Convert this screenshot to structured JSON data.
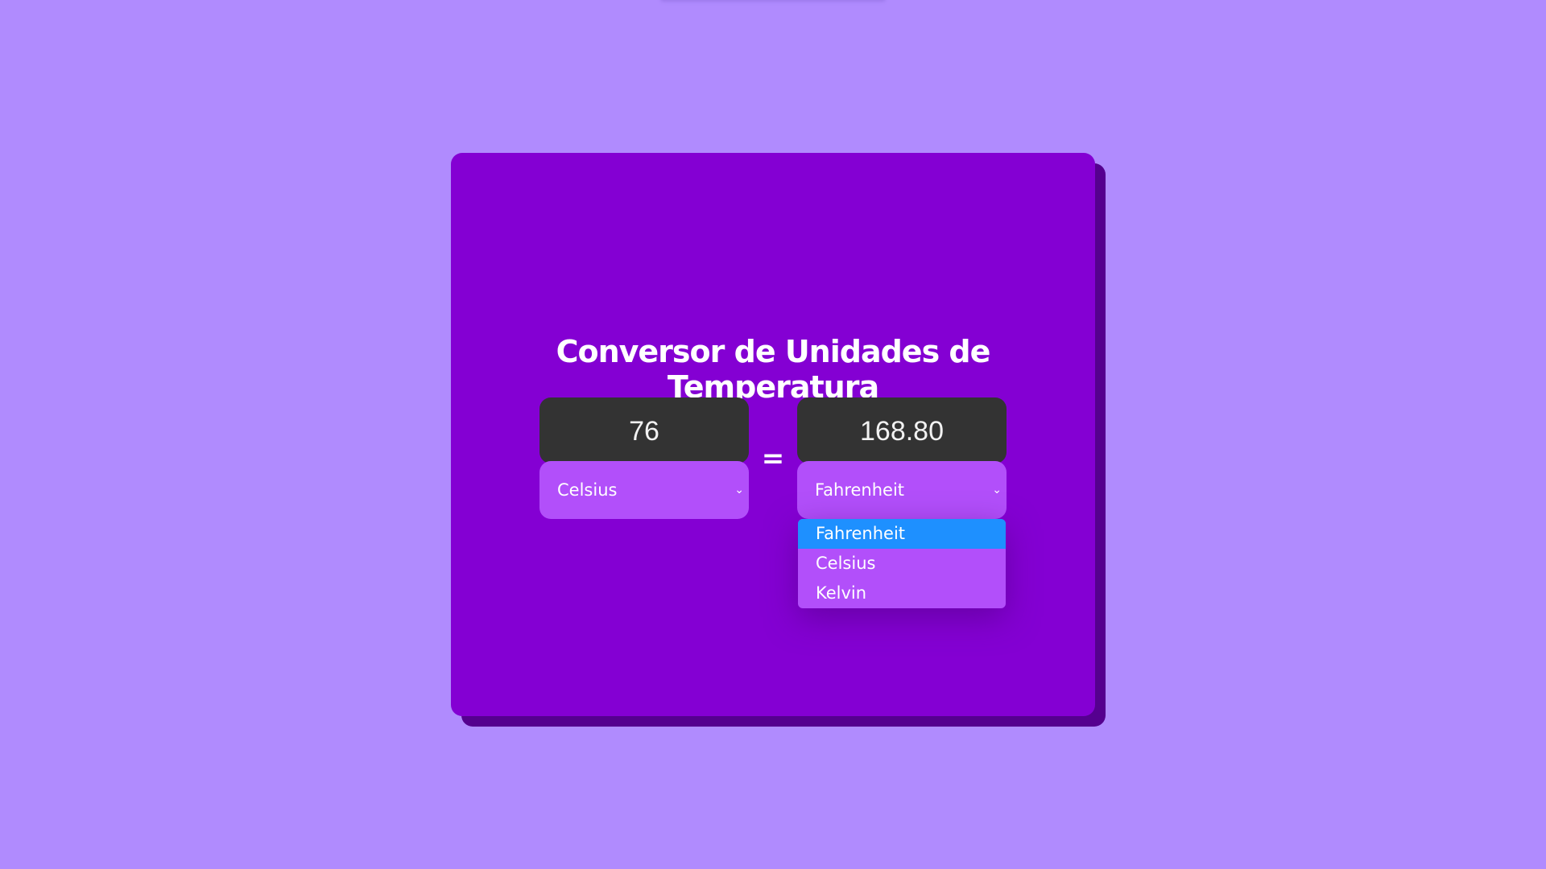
{
  "app": {
    "title": "Conversor de Unidades de Temperatura"
  },
  "converter": {
    "input_value": "76",
    "output_value": "168.80",
    "from_unit": "Celsius",
    "to_unit": "Fahrenheit",
    "equals_sign": "=",
    "unit_options": [
      "Fahrenheit",
      "Celsius",
      "Kelvin"
    ],
    "open_dropdown_selected": "Fahrenheit"
  },
  "colors": {
    "page_background": "#b08bfe",
    "card": "#8400d3",
    "card_shadow": "#55008f",
    "value_box": "#333333",
    "select": "#b24ffa",
    "option_highlight": "#1e90ff"
  },
  "icons": {
    "select_chevron": "chevron-down-icon"
  }
}
